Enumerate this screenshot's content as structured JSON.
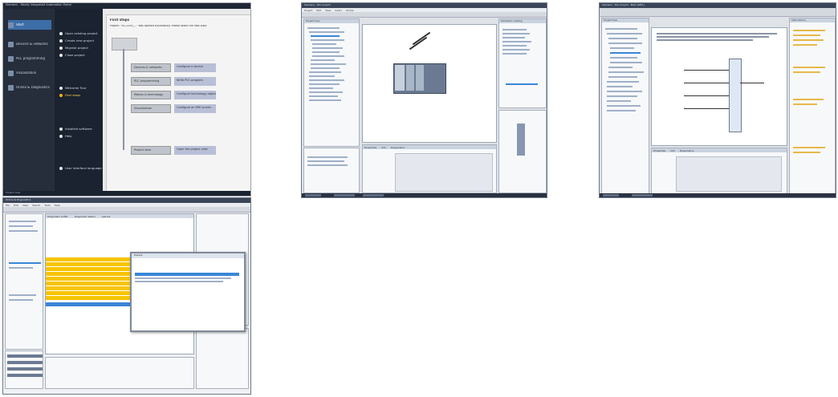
{
  "portal": {
    "window_title": "Siemens - Totally Integrated Automation Portal",
    "brand": "Totally Integrated Automation PORTAL",
    "sidebar": [
      {
        "label": "Start"
      },
      {
        "label": "Devices & networks"
      },
      {
        "label": "PLC programming"
      },
      {
        "label": "Visualization"
      },
      {
        "label": "Online & Diagnostics"
      }
    ],
    "actions": [
      {
        "label": "Open existing project"
      },
      {
        "label": "Create new project"
      },
      {
        "label": "Migrate project"
      },
      {
        "label": "Close project"
      },
      {
        "label": "Welcome Tour"
      },
      {
        "label": "First steps"
      },
      {
        "label": "Installed software"
      },
      {
        "label": "Help"
      },
      {
        "label": "User interface language"
      }
    ],
    "main_heading": "First steps",
    "main_subheading": "Project: \"PLC1200_...\" was opened successfully. Please select the next step:",
    "steps": [
      {
        "button": "Devices & networks",
        "desc": "Configure a device"
      },
      {
        "button": "PLC programming",
        "desc": "Write PLC program"
      },
      {
        "button": "Motion & technology",
        "desc": "Configure technology objects"
      },
      {
        "button": "Visualization",
        "desc": "Configure an HMI screen"
      },
      {
        "button": "Project view",
        "desc": "Open the project view"
      }
    ],
    "status_left": "Project view",
    "status_right": "Opened project: ..."
  },
  "device_view": {
    "window_title": "Siemens - PLC project",
    "menu": [
      "Project",
      "Edit",
      "View",
      "Insert",
      "Online",
      "Options",
      "Tools",
      "Window",
      "Help"
    ],
    "left_pane": "Project tree",
    "right_pane": "Hardware catalog",
    "bottom_tabs": [
      "Properties",
      "Info",
      "Diagnostics"
    ]
  },
  "program_editor": {
    "window_title": "Siemens - PLC project - Main [OB1]",
    "left_pane": "Project tree",
    "right_pane": "Instructions",
    "bottom_tabs": [
      "Properties",
      "Info",
      "Diagnostics"
    ]
  },
  "diagnostics": {
    "window_title": "Online & Diagnostics",
    "menu": [
      "File",
      "Edit",
      "View",
      "Search",
      "Tools",
      "Help"
    ],
    "tabs": [
      "Diagnostic buffer",
      "Diagnostic status",
      "Alarms"
    ],
    "dialog_title": "Details"
  }
}
